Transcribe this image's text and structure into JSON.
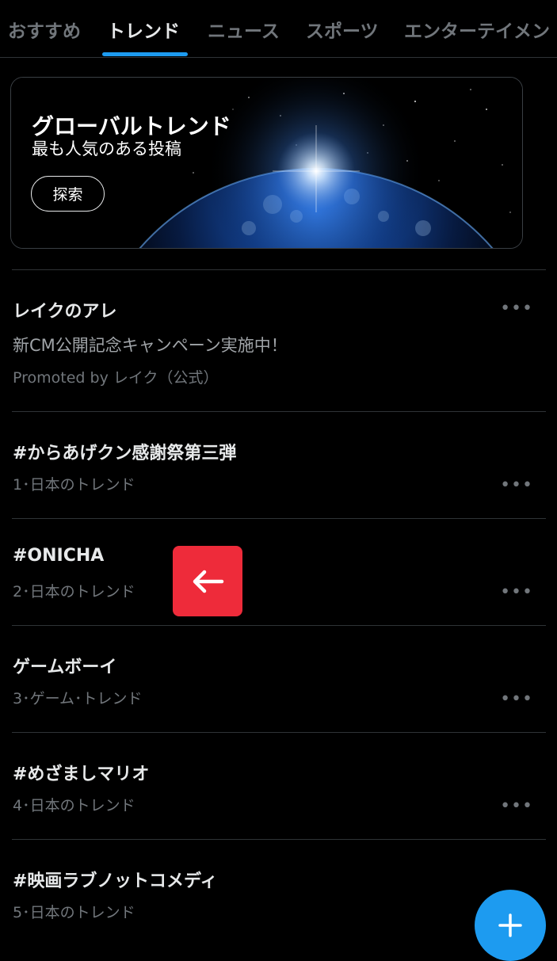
{
  "tabs": [
    {
      "label": "おすすめ",
      "active": false
    },
    {
      "label": "トレンド",
      "active": true
    },
    {
      "label": "ニュース",
      "active": false
    },
    {
      "label": "スポーツ",
      "active": false
    },
    {
      "label": "エンターテイメン",
      "active": false
    }
  ],
  "hero": {
    "title": "グローバルトレンド",
    "subtitle": "最も人気のある投稿",
    "button_label": "探索"
  },
  "promoted": {
    "title": "レイクのアレ",
    "description": "新CM公開記念キャンペーン実施中！",
    "meta": "Promoted by レイク（公式）"
  },
  "trends": [
    {
      "title": "#からあげクン感謝祭第三弾",
      "meta": "1･日本のトレンド"
    },
    {
      "title": "#ONICHA",
      "meta": "2･日本のトレンド"
    },
    {
      "title": "ゲームボーイ",
      "meta": "3･ゲーム･トレンド"
    },
    {
      "title": "#めざましマリオ",
      "meta": "4･日本のトレンド"
    },
    {
      "title": "#映画ラブノットコメディ",
      "meta": "5･日本のトレンド"
    }
  ],
  "more_glyph": "•••",
  "icons": {
    "more": "more-icon",
    "back": "arrow-left-icon",
    "compose": "plus-icon"
  },
  "colors": {
    "accent": "#1d9bf0",
    "back_button": "#ee2b3a",
    "background": "#000000"
  }
}
